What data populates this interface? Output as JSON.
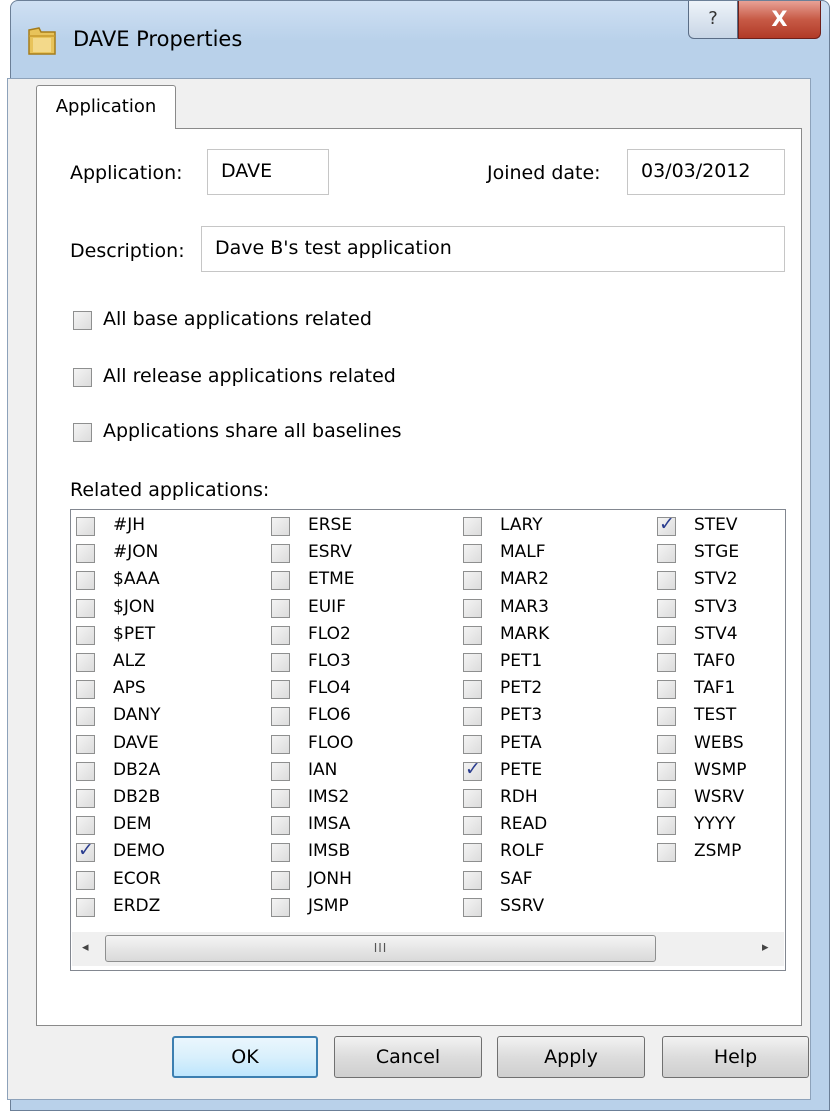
{
  "window": {
    "title": "DAVE Properties",
    "help_glyph": "?",
    "close_glyph": "X"
  },
  "tab": {
    "label": "Application"
  },
  "form": {
    "application_label": "Application:",
    "application_value": "DAVE",
    "joined_label": "Joined date:",
    "joined_value": "03/03/2012",
    "description_label": "Description:",
    "description_value": "Dave B's test application"
  },
  "options": [
    {
      "label": "All base applications related",
      "checked": false
    },
    {
      "label": "All release applications related",
      "checked": false
    },
    {
      "label": "Applications share all baselines",
      "checked": false
    }
  ],
  "related_label": "Related applications:",
  "related": [
    [
      {
        "label": "#JH",
        "checked": false
      },
      {
        "label": "#JON",
        "checked": false
      },
      {
        "label": "$AAA",
        "checked": false
      },
      {
        "label": "$JON",
        "checked": false
      },
      {
        "label": "$PET",
        "checked": false
      },
      {
        "label": "ALZ",
        "checked": false
      },
      {
        "label": "APS",
        "checked": false
      },
      {
        "label": "DANY",
        "checked": false
      },
      {
        "label": "DAVE",
        "checked": false
      },
      {
        "label": "DB2A",
        "checked": false
      },
      {
        "label": "DB2B",
        "checked": false
      },
      {
        "label": "DEM",
        "checked": false
      },
      {
        "label": "DEMO",
        "checked": true
      },
      {
        "label": "ECOR",
        "checked": false
      },
      {
        "label": "ERDZ",
        "checked": false
      }
    ],
    [
      {
        "label": "ERSE",
        "checked": false
      },
      {
        "label": "ESRV",
        "checked": false
      },
      {
        "label": "ETME",
        "checked": false
      },
      {
        "label": "EUIF",
        "checked": false
      },
      {
        "label": "FLO2",
        "checked": false
      },
      {
        "label": "FLO3",
        "checked": false
      },
      {
        "label": "FLO4",
        "checked": false
      },
      {
        "label": "FLO6",
        "checked": false
      },
      {
        "label": "FLOO",
        "checked": false
      },
      {
        "label": "IAN",
        "checked": false
      },
      {
        "label": "IMS2",
        "checked": false
      },
      {
        "label": "IMSA",
        "checked": false
      },
      {
        "label": "IMSB",
        "checked": false
      },
      {
        "label": "JONH",
        "checked": false
      },
      {
        "label": "JSMP",
        "checked": false
      }
    ],
    [
      {
        "label": "LARY",
        "checked": false
      },
      {
        "label": "MALF",
        "checked": false
      },
      {
        "label": "MAR2",
        "checked": false
      },
      {
        "label": "MAR3",
        "checked": false
      },
      {
        "label": "MARK",
        "checked": false
      },
      {
        "label": "PET1",
        "checked": false
      },
      {
        "label": "PET2",
        "checked": false
      },
      {
        "label": "PET3",
        "checked": false
      },
      {
        "label": "PETA",
        "checked": false
      },
      {
        "label": "PETE",
        "checked": true
      },
      {
        "label": "RDH",
        "checked": false
      },
      {
        "label": "READ",
        "checked": false
      },
      {
        "label": "ROLF",
        "checked": false
      },
      {
        "label": "SAF",
        "checked": false
      },
      {
        "label": "SSRV",
        "checked": false
      }
    ],
    [
      {
        "label": "STEV",
        "checked": true
      },
      {
        "label": "STGE",
        "checked": false
      },
      {
        "label": "STV2",
        "checked": false
      },
      {
        "label": "STV3",
        "checked": false
      },
      {
        "label": "STV4",
        "checked": false
      },
      {
        "label": "TAF0",
        "checked": false
      },
      {
        "label": "TAF1",
        "checked": false
      },
      {
        "label": "TEST",
        "checked": false
      },
      {
        "label": "WEBS",
        "checked": false
      },
      {
        "label": "WSMP",
        "checked": false
      },
      {
        "label": "WSRV",
        "checked": false
      },
      {
        "label": "YYYY",
        "checked": false
      },
      {
        "label": "ZSMP",
        "checked": false
      }
    ]
  ],
  "scrollbar": {
    "left_arrow": "◂",
    "right_arrow": "▸",
    "grip": "III"
  },
  "buttons": {
    "ok": "OK",
    "cancel": "Cancel",
    "apply": "Apply",
    "help": "Help"
  }
}
